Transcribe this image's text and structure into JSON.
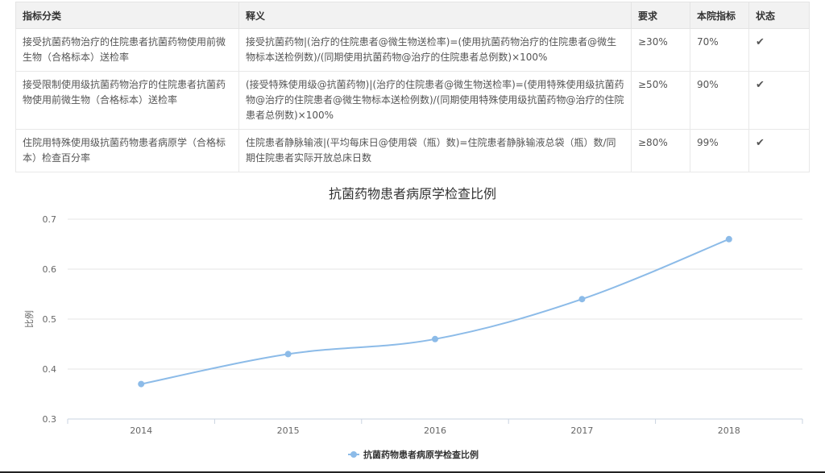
{
  "table": {
    "headers": [
      "指标分类",
      "释义",
      "要求",
      "本院指标",
      "状态"
    ],
    "rows": [
      {
        "category": "接受抗菌药物治疗的住院患者抗菌药物使用前微生物（合格标本）送检率",
        "definition": "接受抗菌药物|(治疗的住院患者@微生物送检率)=(使用抗菌药物治疗的住院患者@微生物标本送检例数)/(同期使用抗菌药物@治疗的住院患者总例数)×100%",
        "requirement": "≥30%",
        "actual": "70%",
        "status_icon": "check-icon"
      },
      {
        "category": "接受限制使用级抗菌药物治疗的住院患者抗菌药物使用前微生物（合格标本）送检率",
        "definition": "(接受特殊使用级@抗菌药物)|(治疗的住院患者@微生物送检率)=(使用特殊使用级抗菌药物@治疗的住院患者@微生物标本送检例数)/(同期使用特殊使用级抗菌药物@治疗的住院患者总例数)×100%",
        "requirement": "≥50%",
        "actual": "90%",
        "status_icon": "check-icon"
      },
      {
        "category": "住院用特殊使用级抗菌药物患者病原学（合格标本）检查百分率",
        "definition": "住院患者静脉输液|(平均每床日@使用袋（瓶）数)=住院患者静脉输液总袋（瓶）数/同期住院患者实际开放总床日数",
        "requirement": "≥80%",
        "actual": "99%",
        "status_icon": "check-icon"
      }
    ]
  },
  "colors": {
    "series": "#8cbbe8",
    "pass": "#2e8b2e",
    "grid": "#e6e6e6",
    "axis": "#c9d3e0",
    "text": "#666666"
  },
  "chart_data": {
    "type": "line",
    "title": "抗菌药物患者病原学检查比例",
    "xlabel": "",
    "ylabel": "比例",
    "categories": [
      "2014",
      "2015",
      "2016",
      "2017",
      "2018"
    ],
    "series": [
      {
        "name": "抗菌药物患者病原学检查比例",
        "values": [
          0.37,
          0.43,
          0.46,
          0.54,
          0.66
        ]
      }
    ],
    "ylim": [
      0.3,
      0.7
    ],
    "yticks": [
      "0.3",
      "0.4",
      "0.5",
      "0.6",
      "0.7"
    ],
    "smooth": true,
    "grid": true,
    "legend": "bottom-center"
  }
}
